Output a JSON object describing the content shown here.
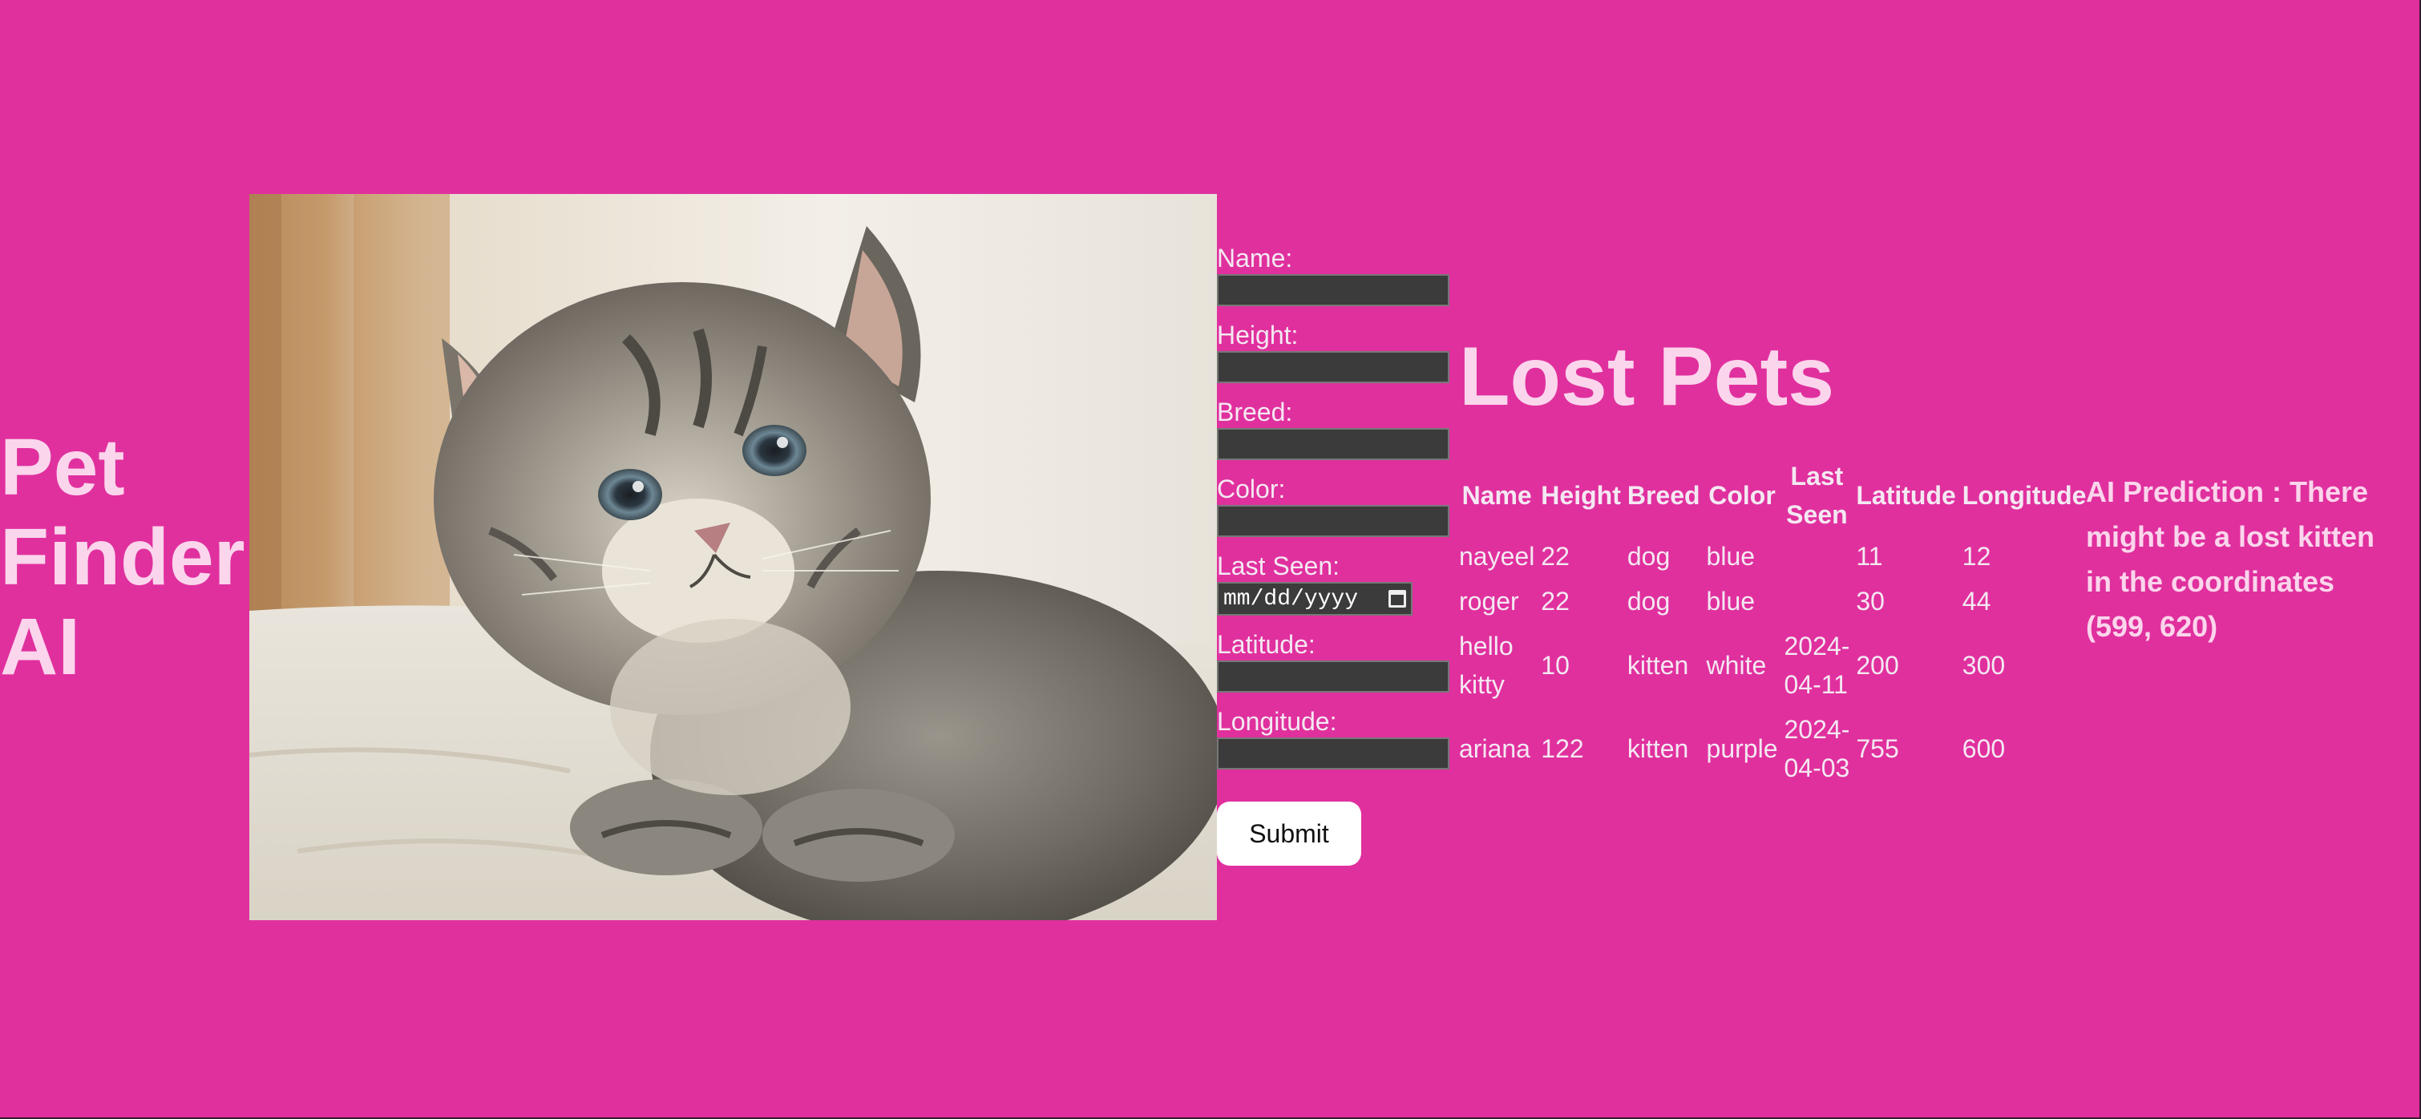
{
  "app": {
    "title": "Pet Finder AI"
  },
  "hero": {
    "image_alt": "Kitten lying on a white blanket"
  },
  "form": {
    "fields": [
      {
        "label": "Name:",
        "value": ""
      },
      {
        "label": "Height:",
        "value": ""
      },
      {
        "label": "Breed:",
        "value": ""
      },
      {
        "label": "Color:",
        "value": ""
      },
      {
        "label": "Last Seen:",
        "placeholder": "mm/dd/yyyy"
      },
      {
        "label": "Latitude:",
        "value": ""
      },
      {
        "label": "Longitude:",
        "value": ""
      }
    ],
    "submit_label": "Submit"
  },
  "lost_pets": {
    "title": "Lost Pets",
    "columns": [
      "Name",
      "Height",
      "Breed",
      "Color",
      "Last Seen",
      "Latitude",
      "Longitude"
    ],
    "rows": [
      [
        "nayeel",
        "22",
        "dog",
        "blue",
        "",
        "11",
        "12"
      ],
      [
        "roger",
        "22",
        "dog",
        "blue",
        "",
        "30",
        "44"
      ],
      [
        "hello kitty",
        "10",
        "kitten",
        "white",
        "2024-04-11",
        "200",
        "300"
      ],
      [
        "ariana",
        "122",
        "kitten",
        "purple",
        "2024-04-03",
        "755",
        "600"
      ]
    ]
  },
  "ai_prediction": {
    "text": "AI Prediction : There might be a lost kitten in the coordinates (599, 620)"
  },
  "colors": {
    "background": "#e0309e",
    "heading_text": "#fbd5ec",
    "input_background": "#3b3b3b",
    "button_background": "#ffffff"
  }
}
